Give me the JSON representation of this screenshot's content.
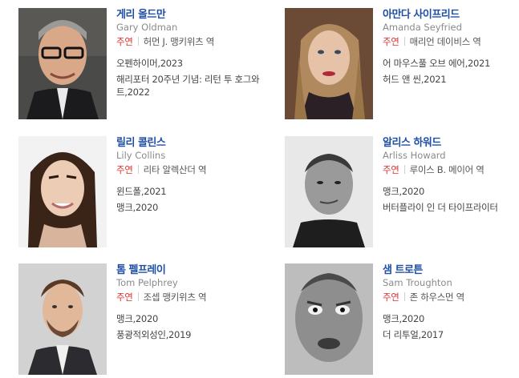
{
  "cast": [
    {
      "name_ko": "게리 올드만",
      "name_en": "Gary Oldman",
      "role_type": "주연",
      "role_name": "허먼 J. 맹키위츠 역",
      "works": [
        "오펜하이머,2023",
        "해리포터 20주년 기념: 리턴 투 호그와트,2022"
      ]
    },
    {
      "name_ko": "아만다 사이프리드",
      "name_en": "Amanda Seyfried",
      "role_type": "주연",
      "role_name": "매리언 데이비스 역",
      "works": [
        "어 마우스풀 오브 에어,2021",
        "허드 앤 씬,2021"
      ]
    },
    {
      "name_ko": "릴리 콜린스",
      "name_en": "Lily Collins",
      "role_type": "주연",
      "role_name": "리타 알렉산더 역",
      "works": [
        "윈드폴,2021",
        "맹크,2020"
      ]
    },
    {
      "name_ko": "알리스 하워드",
      "name_en": "Arliss Howard",
      "role_type": "주연",
      "role_name": "루이스 B. 메이어 역",
      "works": [
        "맹크,2020",
        "버터플라이 인 더 타이프라이터"
      ]
    },
    {
      "name_ko": "톰 펠프레이",
      "name_en": "Tom Pelphrey",
      "role_type": "주연",
      "role_name": "조셉 맹키위츠 역",
      "works": [
        "맹크,2020",
        "풍광적외성인,2019"
      ]
    },
    {
      "name_ko": "샘 트로튼",
      "name_en": "Sam Troughton",
      "role_type": "주연",
      "role_name": "존 하우스먼 역",
      "works": [
        "맹크,2020",
        "더 리투얼,2017"
      ]
    }
  ]
}
